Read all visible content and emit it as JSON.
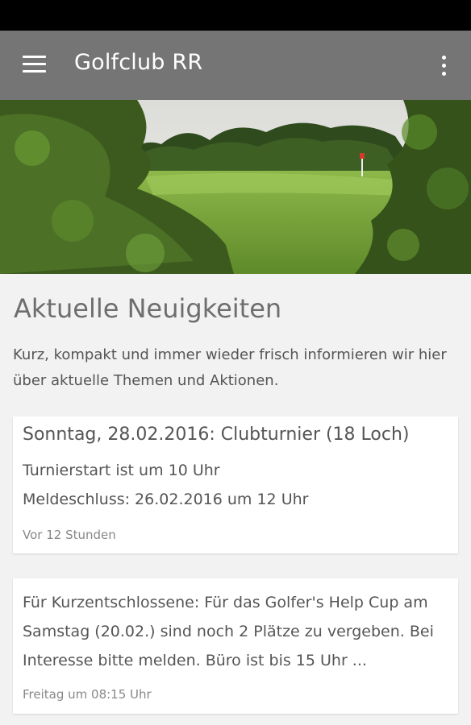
{
  "app": {
    "title": "Golfclub RR",
    "menu_icon": "hamburger-menu-icon",
    "overflow_icon": "more-vert-icon",
    "toolbar_color": "#757575"
  },
  "hero": {
    "image": "golf-course-photo"
  },
  "news": {
    "title": "Aktuelle Neuigkeiten",
    "intro": "Kurz, kompakt und immer wieder frisch informieren wir hier über aktuelle Themen und Aktionen."
  },
  "cards": [
    {
      "title": "Sonntag, 28.02.2016: Clubturnier (18 Loch)",
      "lines": [
        "Turnierstart ist um 10 Uhr",
        "Meldeschluss: 26.02.2016 um 12 Uhr"
      ],
      "time": "Vor 12 Stunden"
    },
    {
      "body": "Für Kurzentschlossene: Für das Golfer's Help Cup am Samstag (20.02.) sind noch 2 Plätze zu vergeben. Bei Interesse bitte melden. Büro ist bis 15 Uhr ...",
      "time": "Freitag um 08:15 Uhr"
    }
  ]
}
